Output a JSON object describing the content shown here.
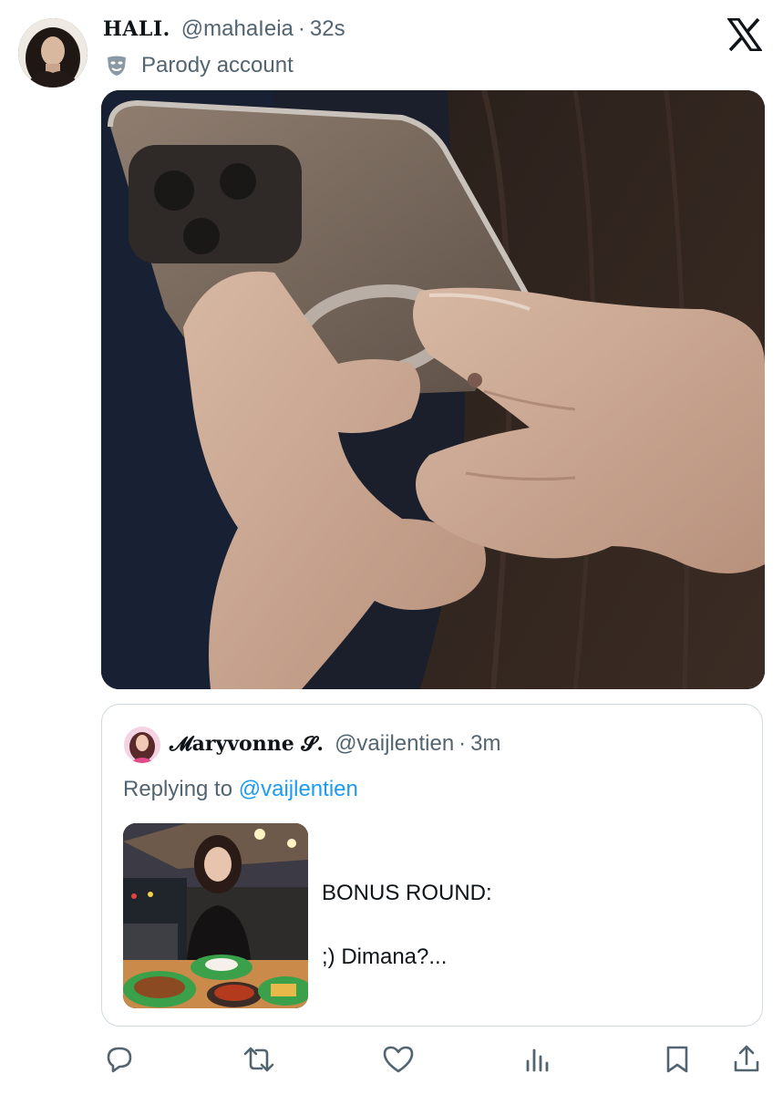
{
  "tweet": {
    "author": {
      "display_name": "HALI.",
      "handle": "@mahaIeia",
      "time": "32s",
      "separator": "·"
    },
    "badge": {
      "icon": "parody-mask-icon",
      "label": "Parody account"
    },
    "platform_logo": "x-logo-icon",
    "media": {
      "kind": "photo"
    }
  },
  "quote": {
    "author": {
      "display_name": "𝓜aryvonne 𝓢.",
      "handle": "@vaijlentien",
      "time": "3m",
      "separator": "·"
    },
    "replying_prefix": "Replying to",
    "replying_mention": "@vaijlentien",
    "text_line1": "BONUS ROUND:",
    "text_line2": ";) Dimana?..."
  },
  "actions": [
    {
      "name": "reply",
      "icon": "reply-icon"
    },
    {
      "name": "repost",
      "icon": "repost-icon"
    },
    {
      "name": "like",
      "icon": "heart-icon"
    },
    {
      "name": "views",
      "icon": "analytics-icon"
    },
    {
      "name": "bookmark",
      "icon": "bookmark-icon"
    },
    {
      "name": "share",
      "icon": "share-icon"
    }
  ],
  "colors": {
    "text_primary": "#0f1419",
    "text_secondary": "#536471",
    "link": "#1d9bf0",
    "border": "#cfd9de"
  }
}
